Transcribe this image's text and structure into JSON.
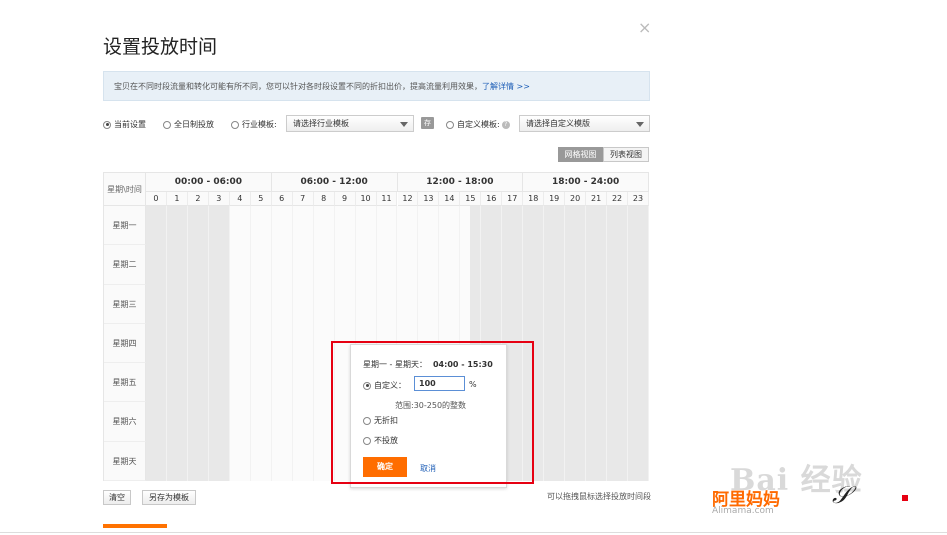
{
  "dialog": {
    "title": "设置投放时间",
    "close_glyph": "×",
    "notice": "宝贝在不同时段流量和转化可能有所不同，您可以针对各时段设置不同的折扣出价，提高流量利用效果，",
    "notice_link": "了解详情 >>"
  },
  "options": {
    "current": "当前设置",
    "all_day": "全日制投放",
    "industry": "行业模板:",
    "industry_select": "请选择行业模板",
    "save_template_glyph": "存",
    "custom": "自定义模板:",
    "help_glyph": "?",
    "custom_select": "请选择自定义模版"
  },
  "view_tabs": {
    "grid": "网格视图",
    "list": "列表视图"
  },
  "grid": {
    "corner": "星期\\时间",
    "periods": [
      "00:00 - 06:00",
      "06:00 - 12:00",
      "12:00 - 18:00",
      "18:00 - 24:00"
    ],
    "hours": [
      "0",
      "1",
      "2",
      "3",
      "4",
      "5",
      "6",
      "7",
      "8",
      "9",
      "10",
      "11",
      "12",
      "13",
      "14",
      "15",
      "16",
      "17",
      "18",
      "19",
      "20",
      "21",
      "22",
      "23"
    ],
    "days": [
      "星期一",
      "星期二",
      "星期三",
      "星期四",
      "星期五",
      "星期六",
      "星期天"
    ]
  },
  "footer": {
    "clear": "清空",
    "save_as": "另存为模板",
    "hint": "可以拖拽鼠标选择投放时间段"
  },
  "popup": {
    "range_label": "星期一 - 星期天：",
    "time_range": "04:00 - 15:30",
    "custom_label": "自定义：",
    "custom_value": "100",
    "percent": "%",
    "range_hint": "范围:30-250的整数",
    "no_discount": "无折扣",
    "no_delivery": "不投放",
    "ok": "确定",
    "cancel": "取消"
  },
  "watermark": {
    "baidu": "Bai 经验",
    "alimama": "阿里妈妈",
    "alimama_url": "Alimama.com"
  },
  "colors": {
    "accent_orange": "#ff6d00",
    "highlight_red": "#e60012",
    "link_blue": "#1f5fb7"
  }
}
